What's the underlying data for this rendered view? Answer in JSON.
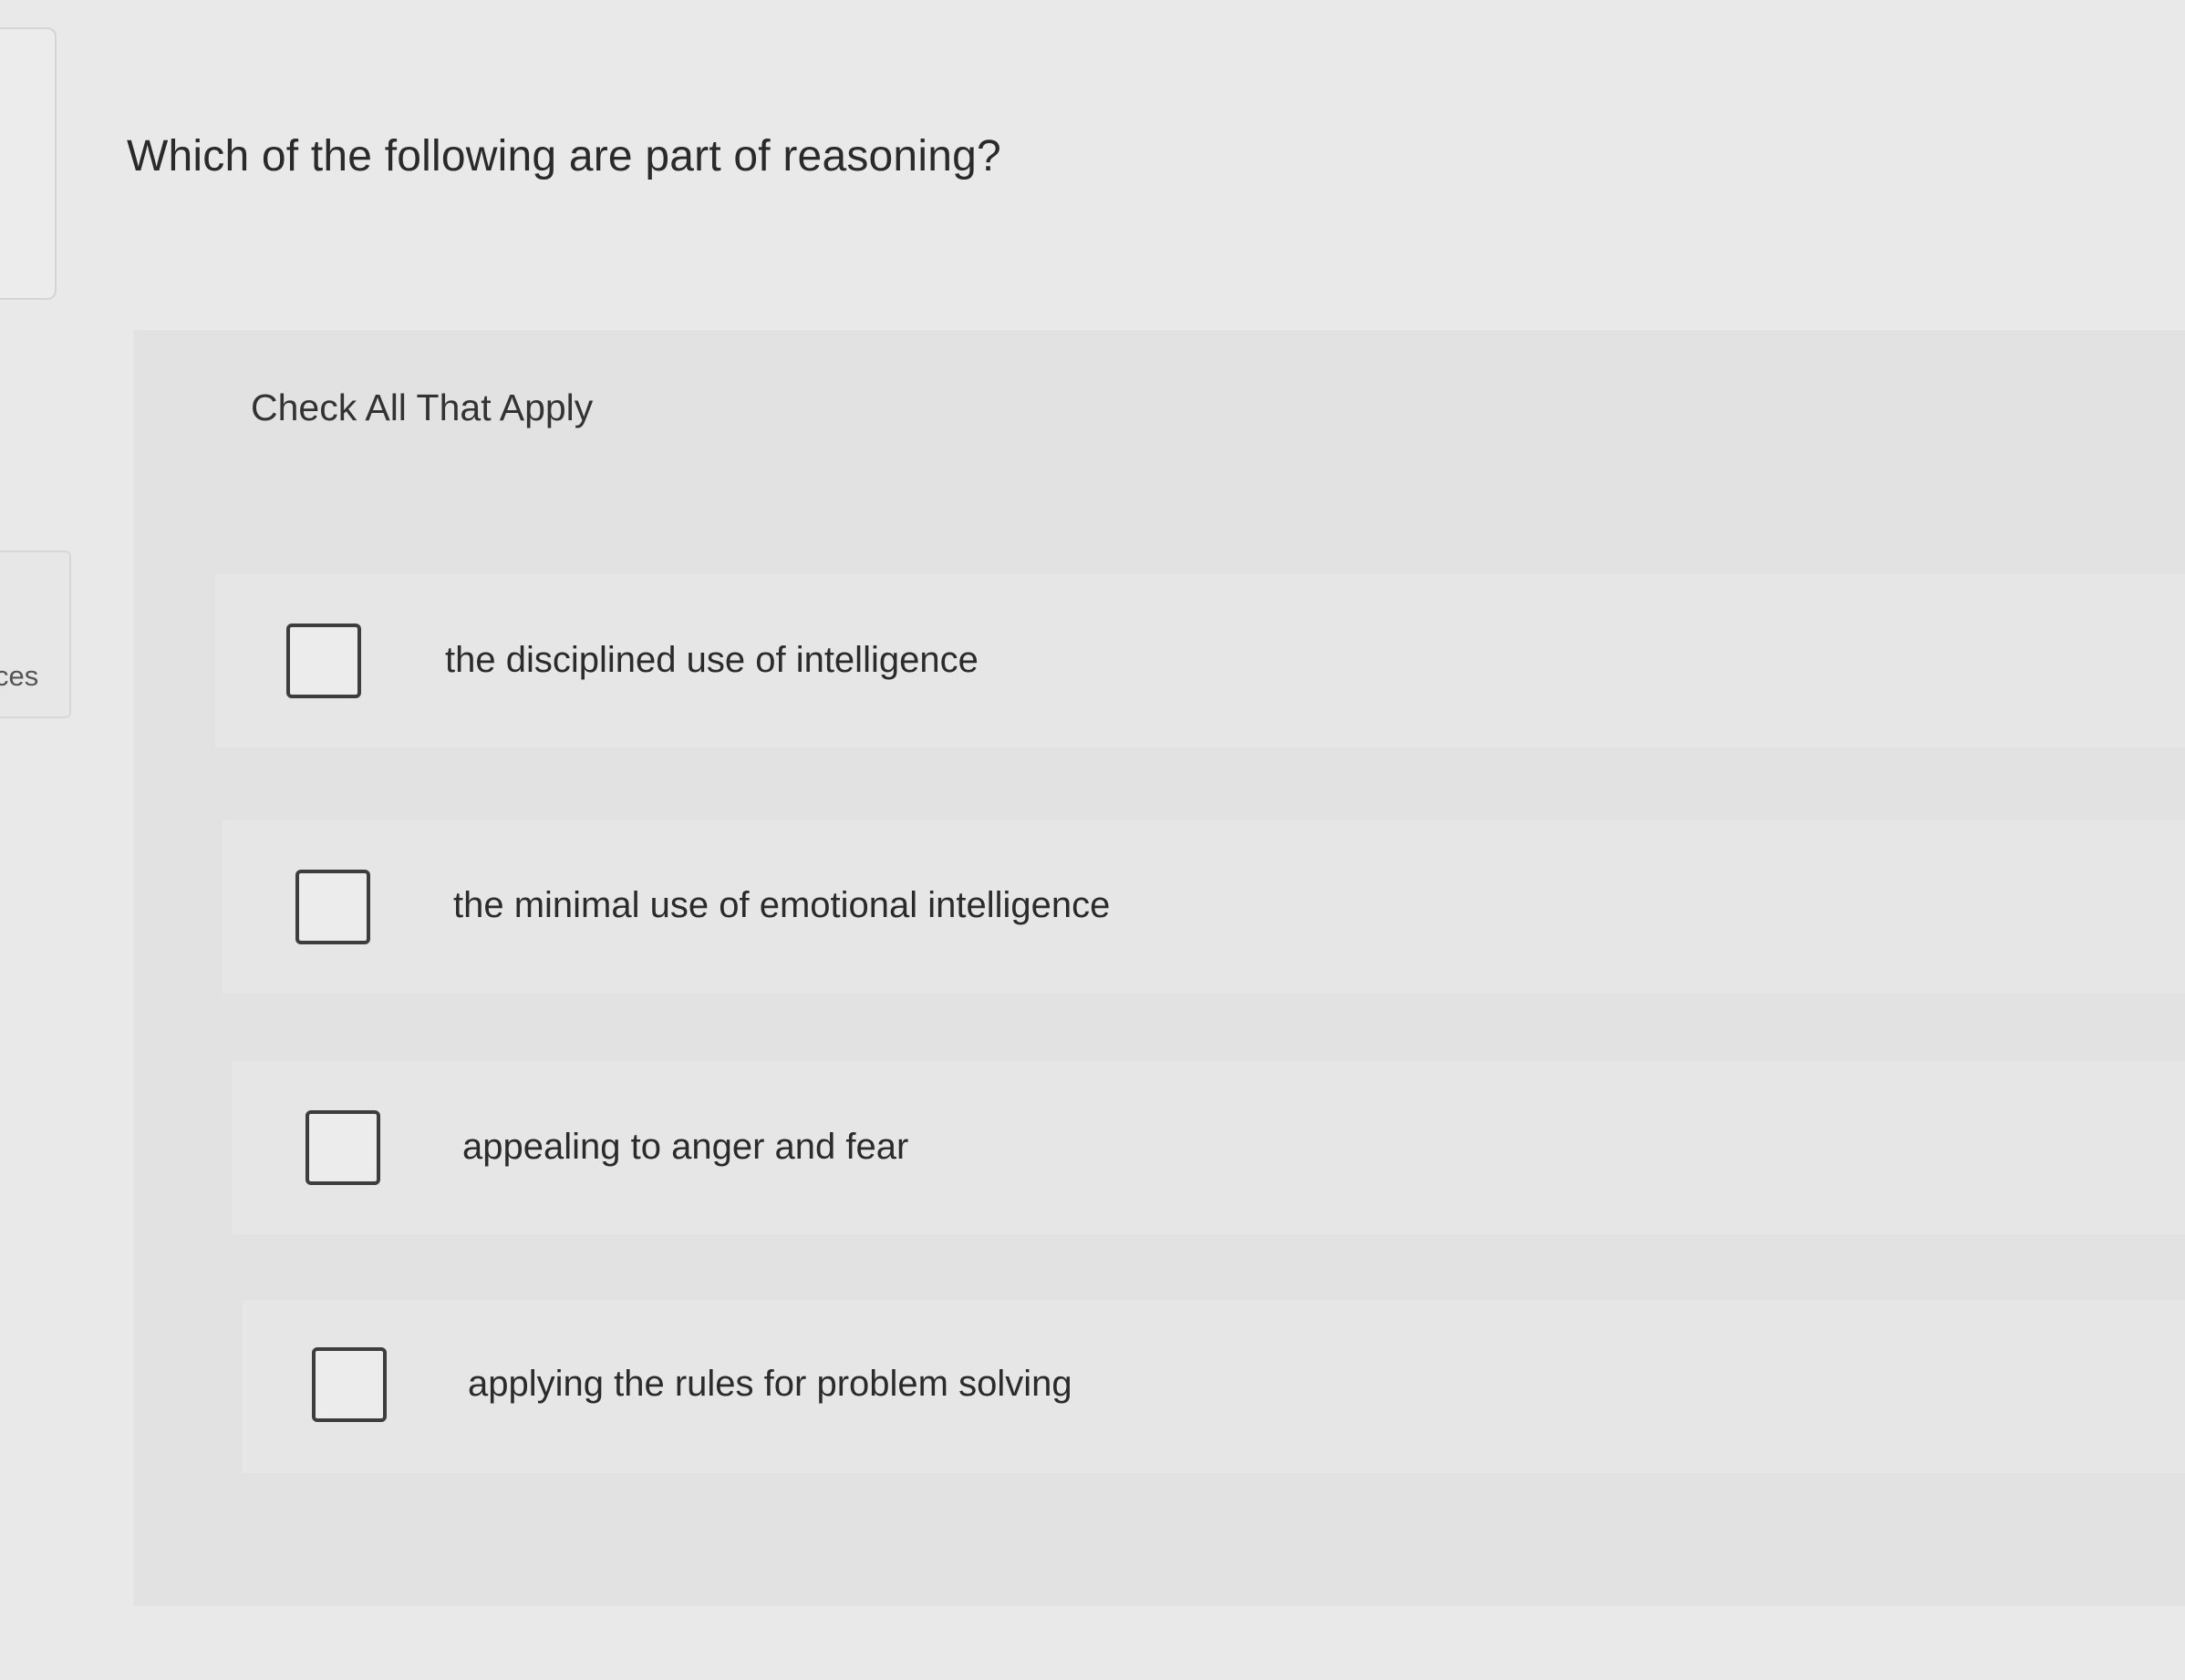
{
  "side": {
    "label": "ces"
  },
  "question": {
    "text": "Which of the following are part of reasoning?"
  },
  "instruction": "Check All That Apply",
  "options": [
    {
      "label": "the disciplined use of intelligence",
      "checked": false
    },
    {
      "label": "the minimal use of emotional intelligence",
      "checked": false
    },
    {
      "label": "appealing to anger and fear",
      "checked": false
    },
    {
      "label": "applying the rules for problem solving",
      "checked": false
    }
  ]
}
